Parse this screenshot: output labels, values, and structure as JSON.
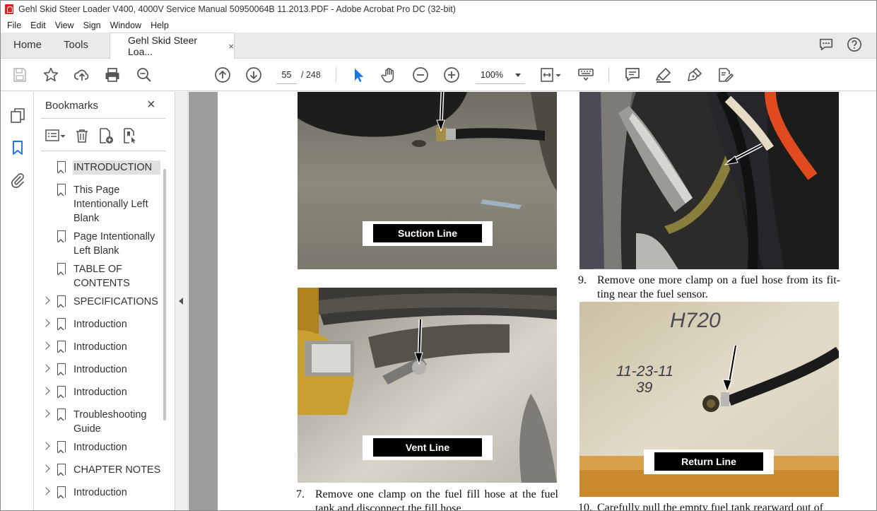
{
  "window": {
    "title": "Gehl Skid Steer Loader V400, 4000V Service Manual 50950064B 11.2013.PDF - Adobe Acrobat Pro DC (32-bit)"
  },
  "menu": [
    "File",
    "Edit",
    "View",
    "Sign",
    "Window",
    "Help"
  ],
  "tabs": {
    "home": "Home",
    "tools": "Tools",
    "document": "Gehl Skid Steer Loa...",
    "close": "×"
  },
  "toolbar": {
    "page_current": "55",
    "page_total": "/   248",
    "zoom": "100%"
  },
  "bookmarks": {
    "title": "Bookmarks",
    "close": "×",
    "items": [
      {
        "label": "INTRODUCTION",
        "expandable": false,
        "selected": true
      },
      {
        "label": "This Page Intentionally Left Blank",
        "expandable": false
      },
      {
        "label": "Page Intentionally Left Blank",
        "expandable": false
      },
      {
        "label": "TABLE OF CONTENTS",
        "expandable": false
      },
      {
        "label": "SPECIFICATIONS",
        "expandable": true
      },
      {
        "label": "Introduction",
        "expandable": true
      },
      {
        "label": "Introduction",
        "expandable": true
      },
      {
        "label": "Introduction",
        "expandable": true
      },
      {
        "label": "Introduction",
        "expandable": true
      },
      {
        "label": "Troubleshooting Guide",
        "expandable": true
      },
      {
        "label": "Introduction",
        "expandable": true
      },
      {
        "label": "CHAPTER NOTES",
        "expandable": true
      },
      {
        "label": "Introduction",
        "expandable": true
      }
    ]
  },
  "page": {
    "captions": {
      "suction": "Suction Line",
      "vent": "Vent Line",
      "return": "Return Line"
    },
    "photo_marking": {
      "line1": "H720",
      "line2": "11-23-11",
      "line3": "39"
    },
    "steps": [
      {
        "num": "9.",
        "text": "Remove one more clamp on a fuel hose from its fit-ting near the fuel sensor."
      },
      {
        "num": "7.",
        "text": "Remove one clamp on the fuel fill hose at the fuel tank and disconnect the fill hose."
      },
      {
        "num": "10.",
        "text": "Carefully pull the empty fuel tank rearward out of"
      }
    ]
  }
}
